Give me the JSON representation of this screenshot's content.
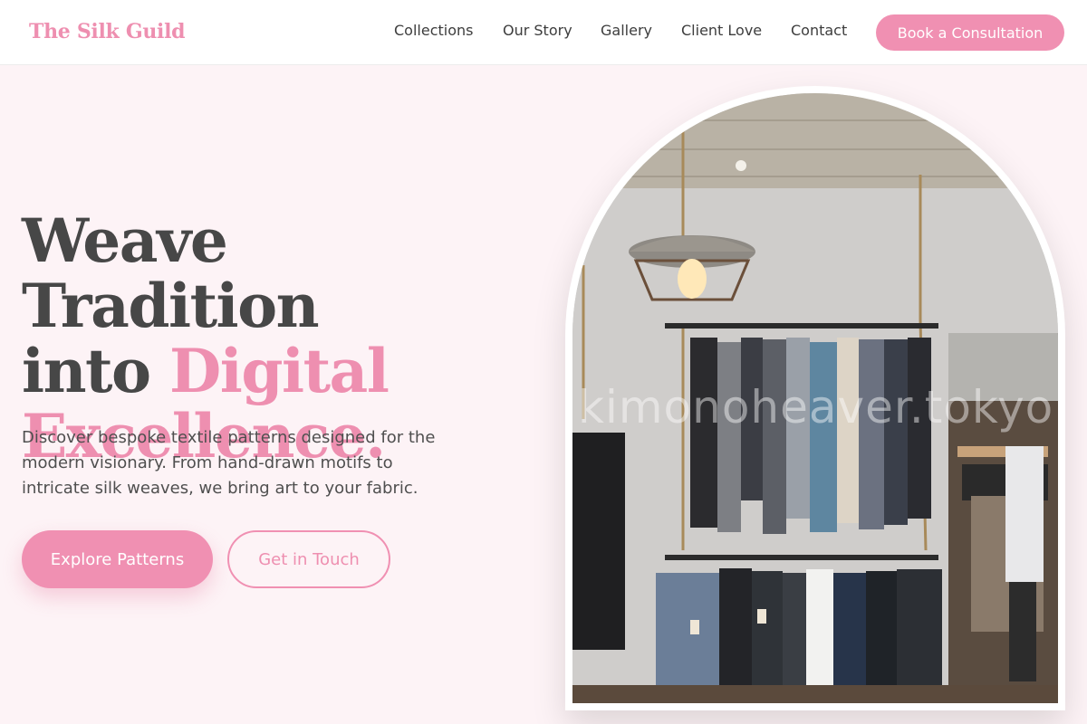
{
  "brand": "The Silk Guild",
  "nav": {
    "items": [
      "Collections",
      "Our Story",
      "Gallery",
      "Client Love",
      "Contact"
    ],
    "cta": "Book a Consultation"
  },
  "hero": {
    "title_line1": "Weave Tradition",
    "title_into": "into ",
    "title_accent": "Digital",
    "title_line3": "Excellence.",
    "description": "Discover bespoke textile patterns designed for the modern visionary. From hand-drawn motifs to intricate silk weaves, we bring art to your fabric.",
    "primary_button": "Explore Patterns",
    "secondary_button": "Get in Touch"
  },
  "image": {
    "subject": "boutique clothing racks with hanging lamp",
    "watermark": "kimonoheaver.tokyo"
  },
  "colors": {
    "accent": "#f090b2",
    "brand": "#ee8fb0",
    "page_background": "#fdf3f6",
    "heading": "#474747"
  }
}
